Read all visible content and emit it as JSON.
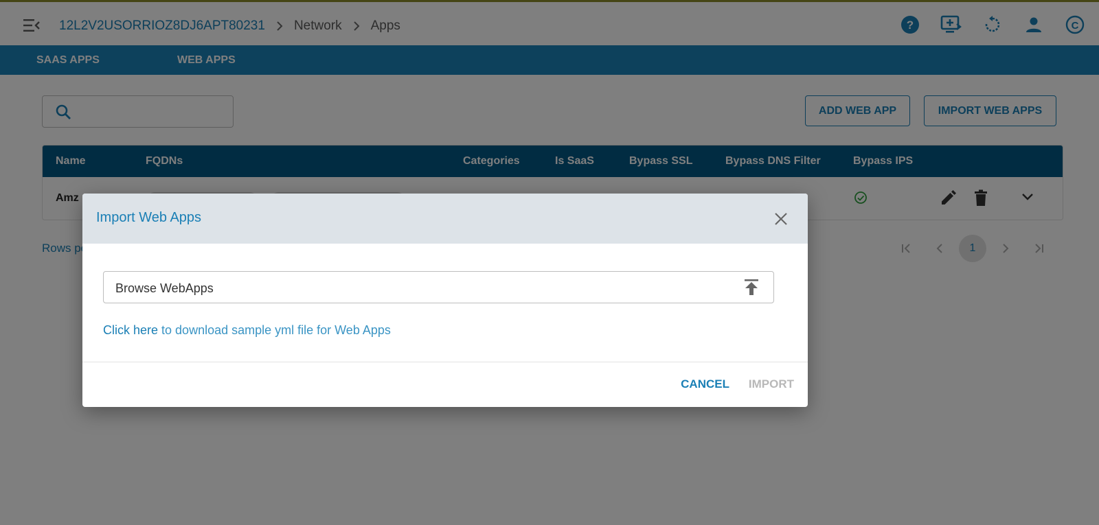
{
  "header": {
    "breadcrumb": [
      "12L2V2USORRIOZ8DJ6APT80231",
      "Network",
      "Apps"
    ],
    "icons": [
      "help-icon",
      "add-screen-icon",
      "refresh-icon",
      "user-icon",
      "copyright-icon"
    ]
  },
  "tabs": [
    {
      "label": "SAAS APPS"
    },
    {
      "label": "WEB APPS"
    }
  ],
  "toolbar": {
    "search_value": "",
    "add_label": "ADD WEB APP",
    "import_label": "IMPORT WEB APPS"
  },
  "table": {
    "columns": [
      "Name",
      "FQDNs",
      "Categories",
      "Is SaaS",
      "Bypass SSL",
      "Bypass DNS Filter",
      "Bypass IPS"
    ],
    "rows": [
      {
        "name": "Amz"
      }
    ]
  },
  "pagination": {
    "rows_label": "Rows pe",
    "current_page": "1"
  },
  "modal": {
    "title": "Import Web Apps",
    "file_label": "Browse WebApps",
    "link_text": "Click here",
    "link_rest": " to download sample yml file for Web Apps",
    "cancel_label": "CANCEL",
    "import_label": "IMPORT"
  },
  "colors": {
    "accent": "#1a7fb5",
    "tab_bar": "#1a83b9",
    "table_header": "#025985",
    "success": "#2e9e3e"
  }
}
